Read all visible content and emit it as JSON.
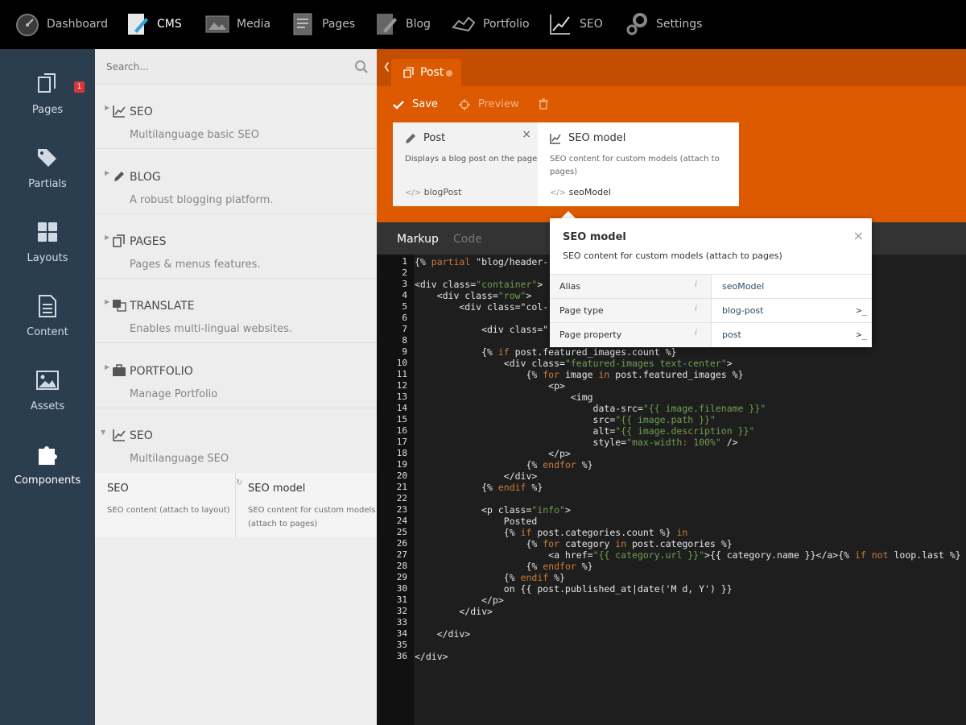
{
  "topnav": {
    "items": [
      {
        "label": "Dashboard",
        "icon": "dashboard-icon"
      },
      {
        "label": "CMS",
        "icon": "cms-icon",
        "active": true
      },
      {
        "label": "Media",
        "icon": "media-icon"
      },
      {
        "label": "Pages",
        "icon": "pages-icon"
      },
      {
        "label": "Blog",
        "icon": "blog-icon"
      },
      {
        "label": "Portfolio",
        "icon": "portfolio-icon"
      },
      {
        "label": "SEO",
        "icon": "seo-icon"
      },
      {
        "label": "Settings",
        "icon": "settings-icon"
      }
    ]
  },
  "sidebar": {
    "items": [
      {
        "label": "Pages",
        "badge": "1"
      },
      {
        "label": "Partials"
      },
      {
        "label": "Layouts"
      },
      {
        "label": "Content"
      },
      {
        "label": "Assets"
      },
      {
        "label": "Components",
        "active": true
      }
    ]
  },
  "search": {
    "placeholder": "Search..."
  },
  "groups": [
    {
      "title": "SEO",
      "desc": "Multilanguage basic SEO",
      "icon": "chart-icon"
    },
    {
      "title": "BLOG",
      "desc": "A robust blogging platform.",
      "icon": "pencil-icon"
    },
    {
      "title": "PAGES",
      "desc": "Pages & menus features.",
      "icon": "copy-icon"
    },
    {
      "title": "TRANSLATE",
      "desc": "Enables multi-lingual websites.",
      "icon": "translate-icon"
    },
    {
      "title": "PORTFOLIO",
      "desc": "Manage Portfolio",
      "icon": "briefcase-icon"
    },
    {
      "title": "SEO",
      "desc": "Multilanguage SEO",
      "icon": "chart-icon",
      "expanded": true
    }
  ],
  "subitems": [
    {
      "title": "SEO",
      "desc": "SEO content (attach to layout)"
    },
    {
      "title": "SEO model",
      "desc_line1": "SEO content for custom models",
      "desc_line2": "(attach to pages)"
    }
  ],
  "editor": {
    "tab_label": "Post",
    "toolbar": {
      "save": "Save",
      "preview": "Preview"
    },
    "cards": [
      {
        "title": "Post",
        "desc": "Displays a blog post on the page.",
        "alias": "blogPost"
      },
      {
        "title": "SEO model",
        "desc_line1": "SEO content for custom models (attach to",
        "desc_line2": "pages)",
        "alias": "seoModel"
      }
    ],
    "code_tabs": {
      "markup": "Markup",
      "code": "Code"
    }
  },
  "popup": {
    "title": "SEO model",
    "desc": "SEO content for custom models (attach to pages)",
    "rows": [
      {
        "label": "Alias",
        "value": "seoModel"
      },
      {
        "label": "Page type",
        "value": "blog-post",
        "terminal": ">_"
      },
      {
        "label": "Page property",
        "value": "post",
        "terminal": ">_"
      }
    ],
    "info_glyph": "i",
    "close_glyph": "×"
  },
  "code_lines": [
    "{% partial \"blog/header-",
    "",
    "<div class=\"container\">",
    "    <div class=\"row\">",
    "        <div class=\"col-",
    "",
    "            <div class=\"",
    "",
    "            {% if post.featured_images.count %}",
    "                <div class=\"featured-images text-center\">",
    "                    {% for image in post.featured_images %}",
    "                        <p>",
    "                            <img",
    "                                data-src=\"{{ image.filename }}\"",
    "                                src=\"{{ image.path }}\"",
    "                                alt=\"{{ image.description }}\"",
    "                                style=\"max-width: 100%\" />",
    "                        </p>",
    "                    {% endfor %}",
    "                </div>",
    "            {% endif %}",
    "",
    "            <p class=\"info\">",
    "                Posted",
    "                {% if post.categories.count %} in",
    "                    {% for category in post.categories %}",
    "                        <a href=\"{{ category.url }}\">{{ category.name }}</a>{% if not loop.last %}",
    "                    {% endfor %}",
    "                {% endif %}",
    "                on {{ post.published_at|date('M d, Y') }}",
    "            </p>",
    "        </div>",
    "",
    "    </div>",
    "",
    "</div>"
  ],
  "colors": {
    "accent": "#dd5a00",
    "sidebar": "#2b3e50",
    "topbar": "#000000"
  }
}
